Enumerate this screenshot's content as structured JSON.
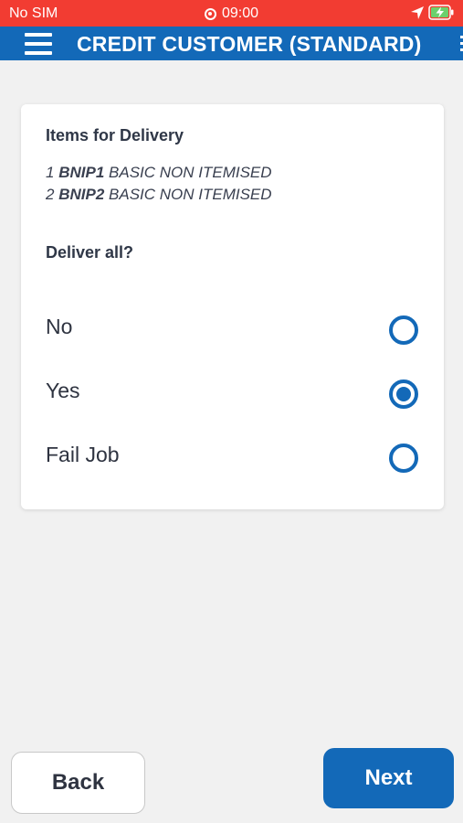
{
  "status_bar": {
    "carrier": "No SIM",
    "time": "09:00",
    "icons": [
      "screen-record-icon",
      "location-arrow-icon",
      "battery-charging-icon"
    ]
  },
  "app_bar": {
    "title": "CREDIT CUSTOMER (STANDARD)",
    "menu_icon": "hamburger-menu-icon"
  },
  "card": {
    "heading": "Items for Delivery",
    "items": [
      {
        "qty": "1",
        "code": "BNIP1",
        "description": "BASIC NON ITEMISED"
      },
      {
        "qty": "2",
        "code": "BNIP2",
        "description": "BASIC NON ITEMISED"
      }
    ],
    "question": "Deliver all?",
    "options": [
      {
        "label": "No",
        "selected": false
      },
      {
        "label": "Yes",
        "selected": true
      },
      {
        "label": "Fail Job",
        "selected": false
      }
    ]
  },
  "footer": {
    "back_label": "Back",
    "next_label": "Next"
  },
  "colors": {
    "status_bar": "#f23c32",
    "primary": "#1369b8",
    "background": "#f1f1f1",
    "text": "#2e3340"
  }
}
